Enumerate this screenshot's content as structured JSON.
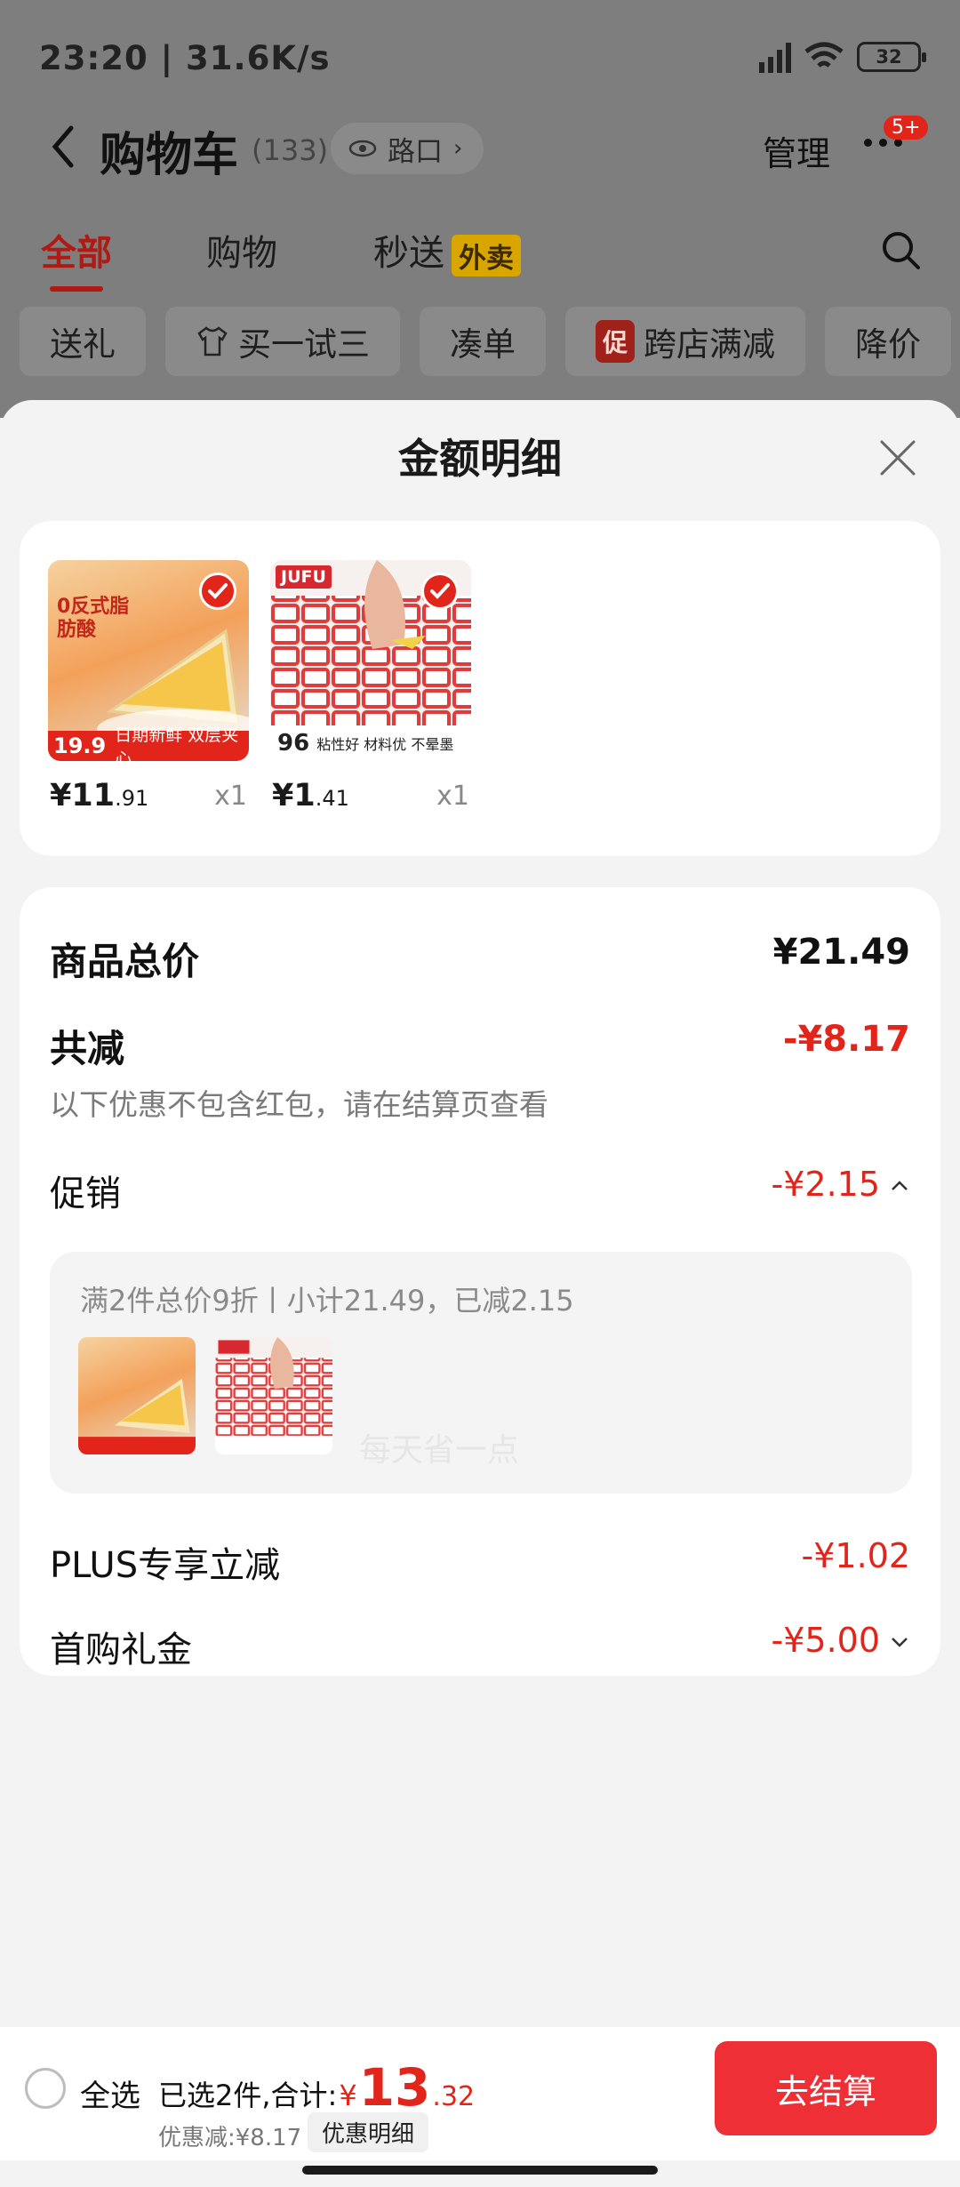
{
  "status_bar": {
    "time": "23:20 | 31.6K/s",
    "battery": "32"
  },
  "header": {
    "title": "购物车",
    "count": "(133)",
    "location": "路口",
    "manage": "管理",
    "more_badge": "5+"
  },
  "tabs": [
    {
      "label": "全部",
      "active": true
    },
    {
      "label": "购物"
    },
    {
      "label": "秒送",
      "tag": "外卖"
    }
  ],
  "chips": [
    "送礼",
    "买一试三",
    "凑单",
    "跨店满减",
    "降价"
  ],
  "chip_promo_icon": "促",
  "sheet": {
    "title": "金额明细",
    "products": [
      {
        "price_int": "¥11",
        "price_dec": ".91",
        "qty": "x1",
        "image_text": [
          "0反式脂肪酸",
          "19.9",
          "日期新鲜 双层夹心"
        ]
      },
      {
        "price_int": "¥1",
        "price_dec": ".41",
        "qty": "x1",
        "image_text": [
          "JUFU",
          "96",
          "粘性好 材料优 不晕墨"
        ]
      }
    ],
    "summary": {
      "total_label": "商品总价",
      "total_value": "¥21.49",
      "reduce_label": "共减",
      "reduce_value": "-¥8.17",
      "reduce_note": "以下优惠不包含红包，请在结算页查看",
      "watermark": "每天省一点",
      "promo_label": "促销",
      "promo_value": "-¥2.15",
      "promo_detail": "满2件总价9折丨小计21.49，已减2.15",
      "plus_label": "PLUS专享立减",
      "plus_value": "-¥1.02",
      "gift_label": "首购礼金",
      "gift_value": "-¥5.00"
    }
  },
  "bottom_bar": {
    "select_all": "全选",
    "selected_text": "已选2件,合计:",
    "currency": "¥",
    "total_int": "13",
    "total_dec": ".32",
    "discount_text": "优惠减:¥8.17",
    "detail_button": "优惠明细",
    "checkout": "去结算"
  },
  "colors": {
    "accent": "#e1251b",
    "checkout": "#ee2f35"
  }
}
